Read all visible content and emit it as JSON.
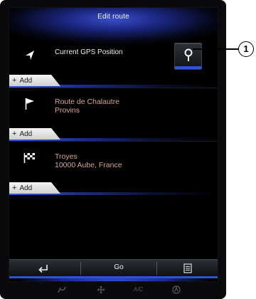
{
  "header": {
    "title": "Edit route"
  },
  "rows": [
    {
      "label": "Current GPS Position"
    },
    {
      "line1": "Route de Chalautre",
      "line2": "Provins"
    },
    {
      "line1": "Troyes",
      "line2": "10000 Aube, France"
    }
  ],
  "add_label": "Add",
  "bottom_bar": {
    "go_label": "Go"
  },
  "climate": {
    "ac_label": "A/C"
  },
  "callout": {
    "number": "1"
  },
  "colors": {
    "accent_blue": "#2a55d8",
    "place_text": "#d9a89a"
  }
}
